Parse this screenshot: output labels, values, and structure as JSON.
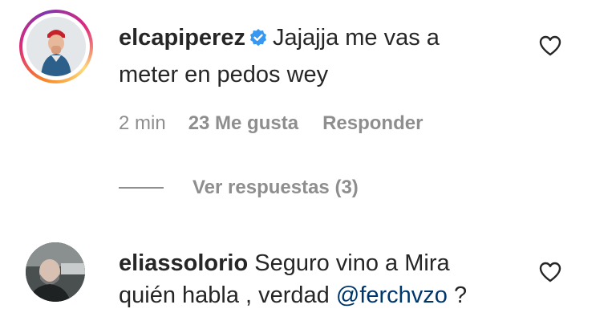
{
  "comments": [
    {
      "username": "elcapiperez",
      "verified": true,
      "text_line1": "Jajajja me vas a",
      "text_line2": "meter en pedos wey",
      "time": "2 min",
      "likes": "23 Me gusta",
      "reply": "Responder",
      "view_replies": "Ver respuestas (3)",
      "like_icon": "heart-outline-icon"
    },
    {
      "username": "eliassolorio",
      "text_line1": "Seguro vino a Mira",
      "text_line2_before": "quién habla , verdad ",
      "mention": "@ferchvzo",
      "text_line2_after": " ?",
      "like_icon": "heart-outline-icon"
    }
  ],
  "colors": {
    "verified": "#3897f0",
    "mention": "#00376b",
    "secondary_text": "#8e8e8e"
  }
}
